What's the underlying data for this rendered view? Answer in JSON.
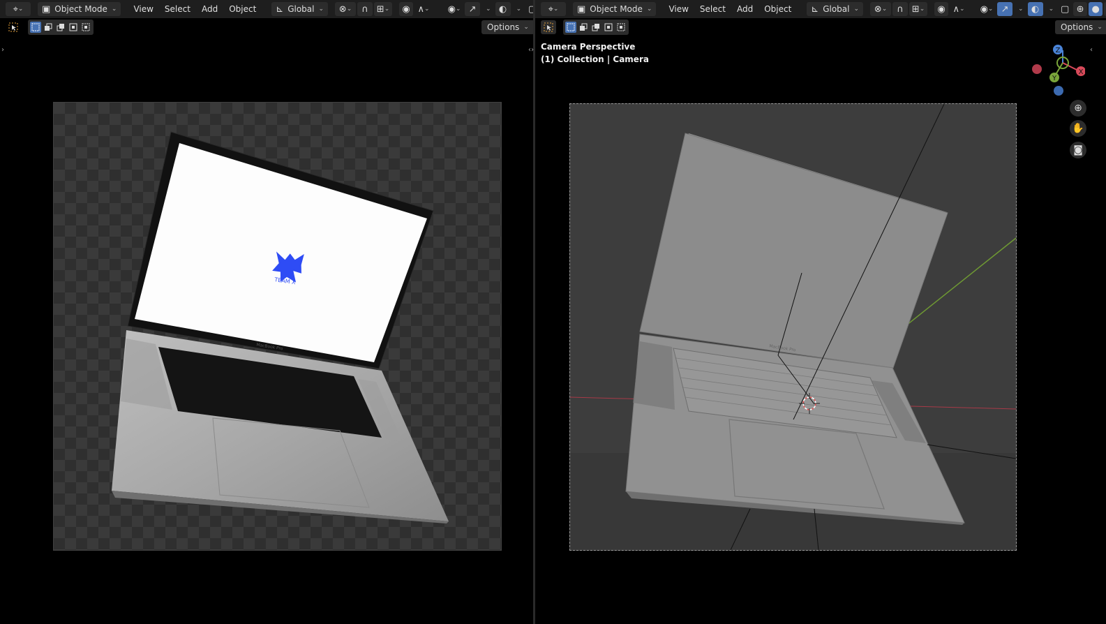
{
  "header": {
    "mode_label": "Object Mode",
    "menus": [
      "View",
      "Select",
      "Add",
      "Object"
    ],
    "orientation_label": "Global"
  },
  "options_label": "Options",
  "right_viewport": {
    "title": "Camera Perspective",
    "subtitle": "(1) Collection | Camera"
  },
  "gizmo": {
    "axes": [
      "Z",
      "Y",
      "X"
    ],
    "colors": {
      "x": "#d84a5a",
      "y": "#7aa63a",
      "z": "#4a84d8"
    }
  },
  "render": {
    "screen_logo_text": "TEAM X",
    "keyboard_brand": "MacBook Pro",
    "logo_color": "#2e4cf5"
  },
  "colors": {
    "accent": "#4772b3",
    "header_bg": "#1e1e1e",
    "viewport_bg": "#000000"
  }
}
